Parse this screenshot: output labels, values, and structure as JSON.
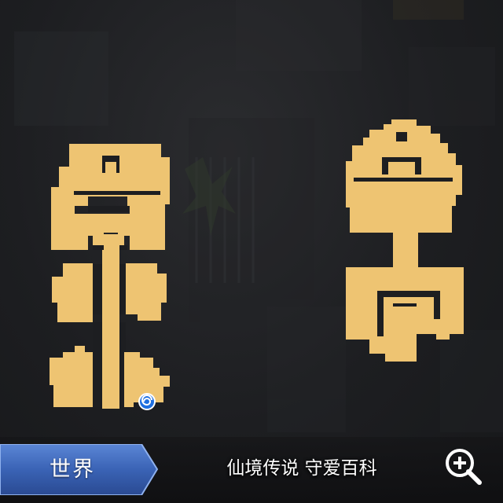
{
  "minimap": {
    "tab_label": "世界",
    "watermark": "仙境传说 守爱百科",
    "room_color": "#eec472",
    "tab_color": "#3a63b5",
    "marker_color": "#1f6fe0",
    "zoom_icon": "zoom-in-magnifier-icon",
    "portal_icon": "spiral-portal-icon"
  }
}
